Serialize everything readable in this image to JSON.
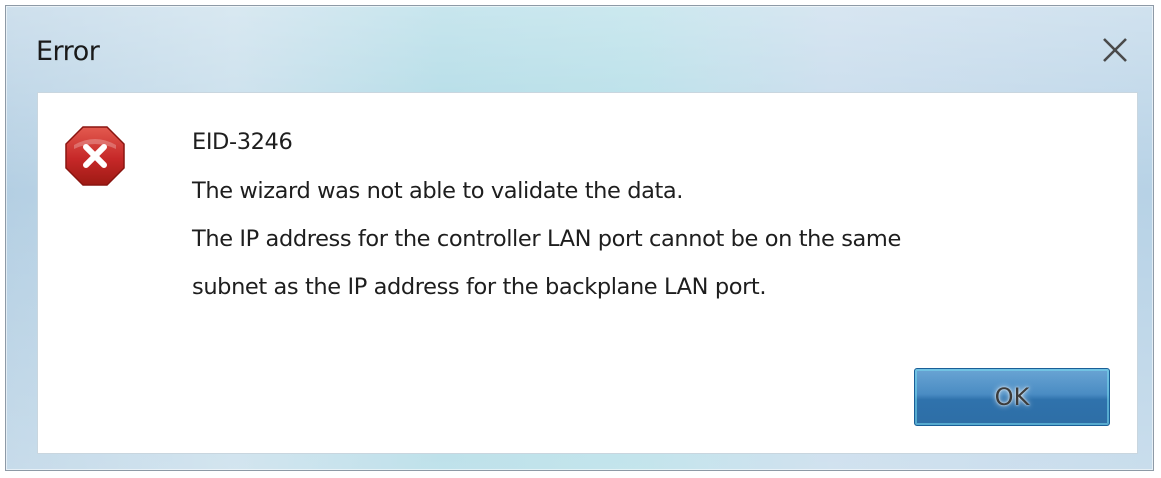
{
  "window": {
    "title": "Error",
    "close_icon": "close-icon"
  },
  "message": {
    "icon": "error-icon",
    "code": "EID-3246",
    "line1": "The wizard was not able to validate the data.",
    "line2": "The IP address for the controller LAN port cannot be on the same",
    "line3": "subnet as the IP address for the backplane LAN port."
  },
  "buttons": {
    "ok_label": "OK"
  },
  "colors": {
    "error_red": "#c62828",
    "button_blue": "#3f83bd"
  }
}
